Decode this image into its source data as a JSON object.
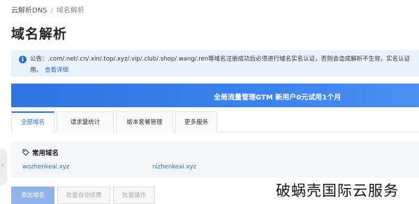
{
  "breadcrumb": {
    "items": [
      "云解析DNS",
      "域名解析"
    ],
    "separator": "/"
  },
  "page_title": "域名解析",
  "notice": {
    "icon": "info-icon",
    "line1": "公告：.com/.net/.cn/.xin/.top/.xyz/.vip/.club/.shop/.wang/.ren等域名注册成功后必须进行域名实名认证，否则会造成解析不生效，实名认证",
    "line2": "用。",
    "link": "查看详细"
  },
  "promo": {
    "text": "全局流量管理GTM 新用户0元试用1个月"
  },
  "tabs": [
    {
      "label": "全部域名",
      "active": true
    },
    {
      "label": "请求量统计",
      "active": false
    },
    {
      "label": "版本套餐管理",
      "active": false
    },
    {
      "label": "更多服务",
      "active": false
    }
  ],
  "frequent": {
    "title": "常用域名",
    "icon": "tag-icon",
    "domains": [
      "wozhenkeai.xyz",
      "nizhenkeai.xyz"
    ]
  },
  "actions": {
    "add_domain": "添加域名",
    "auto_renew": "批量自动续费",
    "batch_ops": "批量操作"
  },
  "watermark": "破蜗壳国际云服务",
  "colors": {
    "accent": "#2a6fd6",
    "notice_bg": "#e8f2fc",
    "promo_bg": "#3a82ec"
  }
}
